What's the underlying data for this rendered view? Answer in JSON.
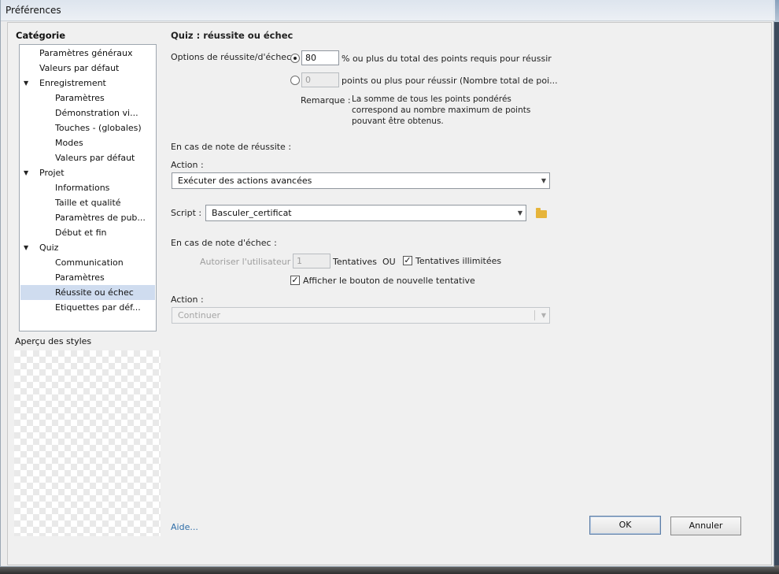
{
  "window": {
    "title": "Préférences"
  },
  "sidebar": {
    "category_label": "Catégorie",
    "items": [
      {
        "label": "Paramètres généraux",
        "level": 0,
        "expandable": false,
        "selected": false
      },
      {
        "label": "Valeurs par défaut",
        "level": 0,
        "expandable": false,
        "selected": false
      },
      {
        "label": "Enregistrement",
        "level": 0,
        "expandable": true,
        "selected": false
      },
      {
        "label": "Paramètres",
        "level": 1,
        "expandable": false,
        "selected": false
      },
      {
        "label": "Démonstration vi...",
        "level": 1,
        "expandable": false,
        "selected": false
      },
      {
        "label": "Touches - (globales)",
        "level": 1,
        "expandable": false,
        "selected": false
      },
      {
        "label": "Modes",
        "level": 1,
        "expandable": false,
        "selected": false
      },
      {
        "label": "Valeurs par défaut",
        "level": 1,
        "expandable": false,
        "selected": false
      },
      {
        "label": "Projet",
        "level": 0,
        "expandable": true,
        "selected": false
      },
      {
        "label": "Informations",
        "level": 1,
        "expandable": false,
        "selected": false
      },
      {
        "label": "Taille et qualité",
        "level": 1,
        "expandable": false,
        "selected": false
      },
      {
        "label": "Paramètres de pub...",
        "level": 1,
        "expandable": false,
        "selected": false
      },
      {
        "label": "Début et fin",
        "level": 1,
        "expandable": false,
        "selected": false
      },
      {
        "label": "Quiz",
        "level": 0,
        "expandable": true,
        "selected": false
      },
      {
        "label": "Communication",
        "level": 1,
        "expandable": false,
        "selected": false
      },
      {
        "label": "Paramètres",
        "level": 1,
        "expandable": false,
        "selected": false
      },
      {
        "label": "Réussite ou échec",
        "level": 1,
        "expandable": false,
        "selected": true
      },
      {
        "label": "Etiquettes par déf...",
        "level": 1,
        "expandable": false,
        "selected": false
      }
    ],
    "expand_glyph": "▼",
    "preview_label": "Aperçu des styles"
  },
  "panel": {
    "title": "Quiz : réussite ou échec",
    "options_label": "Options de réussite/d'échec :",
    "percent_value": "80",
    "percent_text": "% ou plus du total des points requis pour réussir",
    "points_value": "0",
    "points_text": "points ou plus pour réussir (Nombre total de poi...",
    "remark_label": "Remarque :",
    "remark_lines": [
      "La somme de tous les points pondérés",
      "correspond au nombre maximum de points",
      "pouvant être obtenus."
    ],
    "pass_section": "En cas de note de réussite :",
    "action_label": "Action :",
    "pass_action": "Exécuter des actions avancées",
    "script_label": "Script :",
    "script_value": "Basculer_certificat",
    "fail_section": "En cas de note d'échec :",
    "allow_user_label": "Autoriser l'utilisateur :",
    "attempts_value": "1",
    "attempts_label": "Tentatives",
    "or_label": "OU",
    "unlimited_label": "Tentatives illimitées",
    "unlimited_checked": true,
    "show_retry_label": "Afficher le bouton de nouvelle tentative",
    "show_retry_checked": true,
    "fail_action_label": "Action :",
    "fail_action": "Continuer",
    "check_glyph": "✓",
    "caret_glyph": "▼"
  },
  "footer": {
    "help_link": "Aide...",
    "ok_label": "OK",
    "cancel_label": "Annuler"
  },
  "colors": {
    "selection": "#cfdcef",
    "link": "#2f6ea8",
    "folder": "#e6b43a"
  },
  "icons": {
    "folder": "folder-icon",
    "expand": "triangle-down-icon",
    "caret": "chevron-down-icon"
  }
}
